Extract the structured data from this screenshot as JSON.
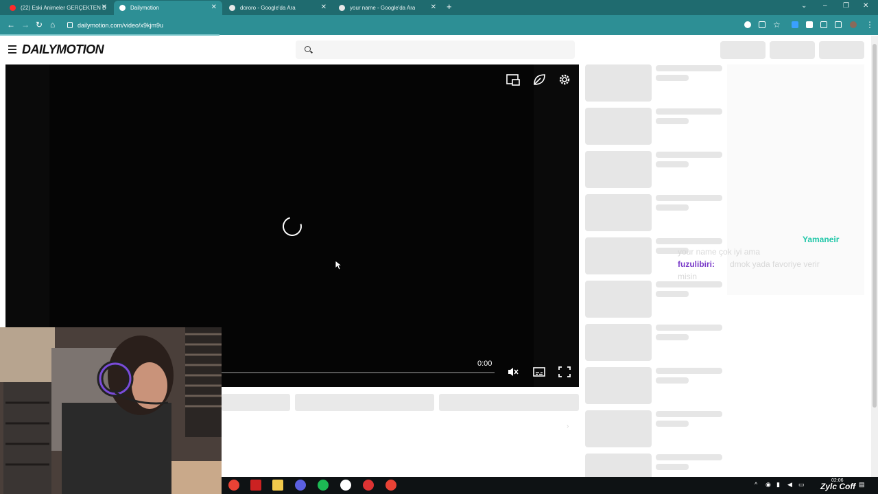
{
  "browser": {
    "tabs": [
      {
        "label": "(22) Eski Animeler GERÇEKTEN D",
        "active": false,
        "favicon": "youtube-icon"
      },
      {
        "label": "Dailymotion",
        "active": true,
        "favicon": "dailymotion-icon"
      },
      {
        "label": "dororo - Google'da Ara",
        "active": false,
        "favicon": "google-icon"
      },
      {
        "label": "your name - Google'da Ara",
        "active": false,
        "favicon": "google-icon"
      }
    ],
    "new_tab": "+",
    "url": "dailymotion.com/video/x9kjm9u"
  },
  "site": {
    "logo": "DAILYMOTION"
  },
  "player": {
    "state": "loading",
    "timecode": "0:00",
    "controls": [
      "picture-in-picture-icon",
      "eco-leaf-icon",
      "settings-icon",
      "mute-icon",
      "subtitles-icon",
      "fullscreen-icon"
    ]
  },
  "chat": {
    "messages": [
      {
        "user": "Yamaneir",
        "text": "your name çok iyi ama"
      },
      {
        "user": "fuzulibiri:",
        "text": "dmok yada favoriye verir",
        "text_cont": "misin"
      }
    ]
  },
  "taskbar": {
    "clock_time": "02:06",
    "watermark": "Zylc Coff"
  },
  "colors": {
    "tab_strip": "#1f6b6f",
    "toolbar": "#2d8f95",
    "chat_user1": "#20c7a8",
    "chat_user2": "#7a3bc9"
  }
}
